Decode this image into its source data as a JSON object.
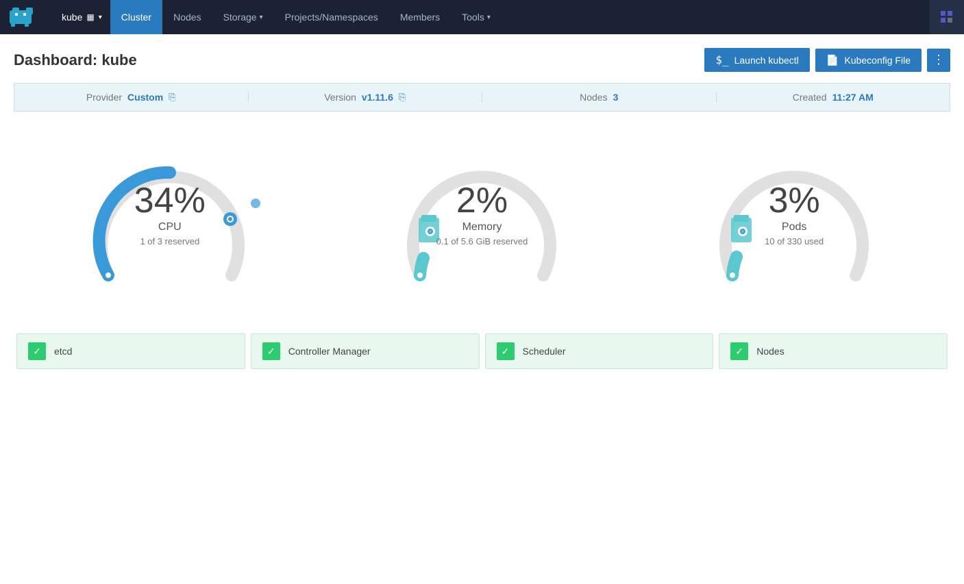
{
  "navbar": {
    "brand_alt": "Rancher Hippo",
    "cluster_name": "kube",
    "nav_items": [
      {
        "label": "Cluster",
        "active": true,
        "dropdown": false
      },
      {
        "label": "Nodes",
        "active": false,
        "dropdown": false
      },
      {
        "label": "Storage",
        "active": false,
        "dropdown": true
      },
      {
        "label": "Projects/Namespaces",
        "active": false,
        "dropdown": false
      },
      {
        "label": "Members",
        "active": false,
        "dropdown": false
      },
      {
        "label": "Tools",
        "active": false,
        "dropdown": true
      }
    ]
  },
  "page": {
    "title_prefix": "Dashboard:",
    "title_name": "kube",
    "btn_kubectl": "Launch kubectl",
    "btn_kubeconfig": "Kubeconfig File",
    "btn_more_label": "⋮"
  },
  "info_bar": {
    "provider_label": "Provider",
    "provider_value": "Custom",
    "version_label": "Version",
    "version_value": "v1.11.6",
    "nodes_label": "Nodes",
    "nodes_value": "3",
    "created_label": "Created",
    "created_value": "11:27 AM"
  },
  "gauges": [
    {
      "id": "cpu",
      "percent": "34%",
      "label": "CPU",
      "sublabel": "1 of 3 reserved",
      "fill_ratio": 0.34,
      "color": "#3a9ad9"
    },
    {
      "id": "memory",
      "percent": "2%",
      "label": "Memory",
      "sublabel": "0.1 of 5.6 GiB reserved",
      "fill_ratio": 0.02,
      "color": "#5bc8d0"
    },
    {
      "id": "pods",
      "percent": "3%",
      "label": "Pods",
      "sublabel": "10 of 330 used",
      "fill_ratio": 0.03,
      "color": "#5bc8d0"
    }
  ],
  "status_items": [
    {
      "label": "etcd"
    },
    {
      "label": "Controller Manager"
    },
    {
      "label": "Scheduler"
    },
    {
      "label": "Nodes"
    }
  ]
}
